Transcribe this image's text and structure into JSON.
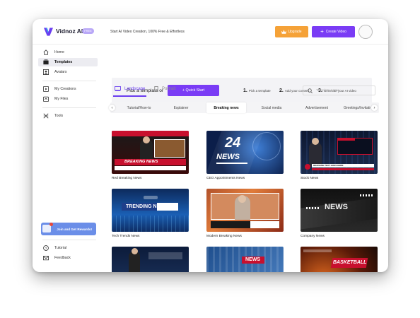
{
  "app": {
    "logo_name": "Vidnoz AI",
    "badge": "FREE",
    "tagline": "Start AI Video Creation, 100% Free & Effortless",
    "upgrade_label": "Upgrade",
    "create_label": "Create Video"
  },
  "sidebar": {
    "items": [
      {
        "label": "Home",
        "icon": "home-icon"
      },
      {
        "label": "Templates",
        "icon": "templates-icon",
        "active": true
      },
      {
        "label": "Avatars",
        "icon": "avatar-icon"
      },
      {
        "label": "My Creations",
        "icon": "play-icon"
      },
      {
        "label": "My Files",
        "icon": "files-icon"
      },
      {
        "label": "Tools",
        "icon": "tools-icon"
      }
    ],
    "reward_label": "Join and Get Rewards!",
    "bottom_items": [
      {
        "label": "Tutorial",
        "icon": "help-icon"
      },
      {
        "label": "Feedback",
        "icon": "mail-icon"
      }
    ]
  },
  "hero": {
    "title": "Pick a template or",
    "quick_start": "+ Quick Start",
    "steps": [
      {
        "num": "1.",
        "text": "Pick a template"
      },
      {
        "num": "2.",
        "text": "Add your content"
      },
      {
        "num": "3.",
        "text": "Generate your AI video"
      }
    ]
  },
  "orientation": {
    "landscape": "Landscape",
    "portrait": "Portrait"
  },
  "search": {
    "placeholder": "Template name"
  },
  "categories": {
    "items": [
      "Tutorial/How-to",
      "Explainer",
      "Breaking news",
      "Social media",
      "Advertisement",
      "Greetings/Invitation"
    ],
    "active": "Breaking news"
  },
  "templates": [
    {
      "title": "Red Breaking News",
      "overlay": "BREAKING NEWS"
    },
    {
      "title": "CEO Appointments News",
      "overlay": "24 NEWS",
      "overlay_number": "24"
    },
    {
      "title": "Stock News",
      "overlay": "HEADLINE TEXT GOES HERE"
    },
    {
      "title": "Tech Trends News",
      "overlay": "TRENDING NEWS"
    },
    {
      "title": "Modern Breaking News",
      "overlay": ""
    },
    {
      "title": "Company News",
      "overlay": "NEWS"
    },
    {
      "title": "",
      "overlay": ""
    },
    {
      "title": "",
      "overlay": "NEWS"
    },
    {
      "title": "",
      "overlay": "BASKETBALL"
    }
  ],
  "colors": {
    "accent": "#7a3cf5",
    "upgrade": "#f5a238",
    "reward": "#6b8ee8"
  }
}
